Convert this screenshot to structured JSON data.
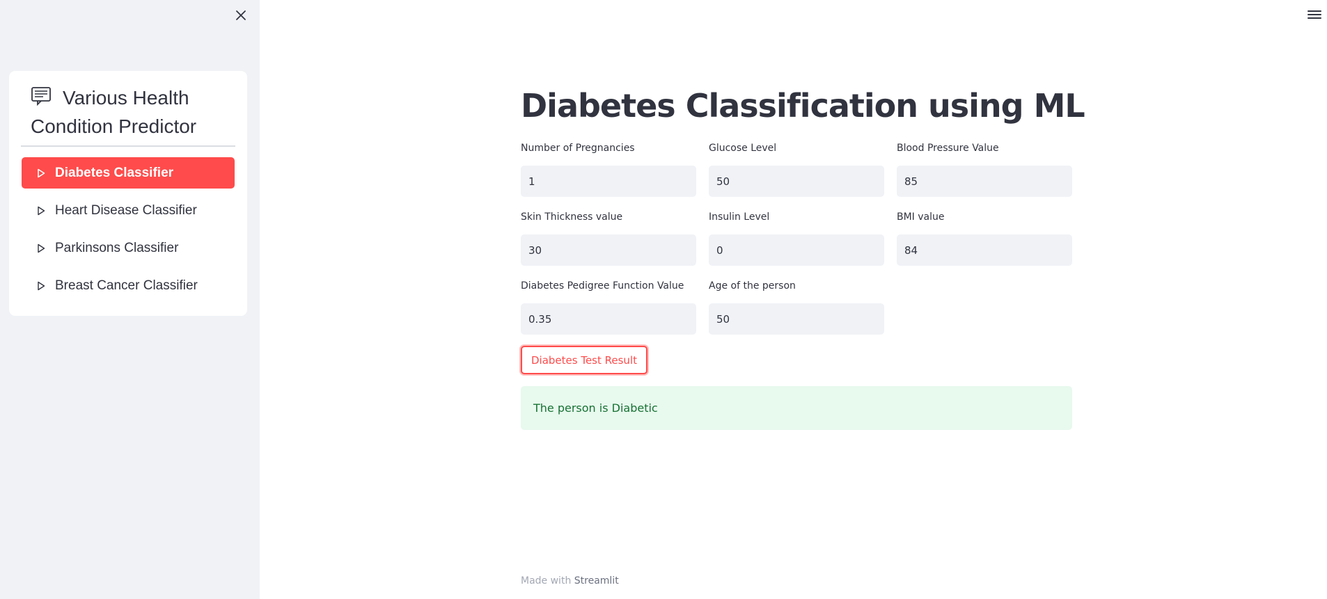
{
  "sidebar": {
    "menu_title": "Various Health Condition Predictor",
    "items": [
      {
        "label": "Diabetes Classifier",
        "active": true
      },
      {
        "label": "Heart Disease Classifier",
        "active": false
      },
      {
        "label": "Parkinsons Classifier",
        "active": false
      },
      {
        "label": "Breast Cancer Classifier",
        "active": false
      }
    ],
    "icons": {
      "close": "close-icon",
      "menu_header": "notes-icon",
      "item": "play-triangle-icon"
    }
  },
  "header": {
    "menu_icon": "hamburger-icon"
  },
  "main": {
    "title": "Diabetes Classification using ML",
    "fields": [
      {
        "label": "Number of Pregnancies",
        "value": "1"
      },
      {
        "label": "Glucose Level",
        "value": "50"
      },
      {
        "label": "Blood Pressure Value",
        "value": "85"
      },
      {
        "label": "Skin Thickness value",
        "value": "30"
      },
      {
        "label": "Insulin Level",
        "value": "0"
      },
      {
        "label": "BMI value",
        "value": "84"
      },
      {
        "label": "Diabetes Pedigree Function Value",
        "value": "0.35"
      },
      {
        "label": "Age of the person",
        "value": "50"
      }
    ],
    "button_label": "Diabetes Test Result",
    "result_text": "The person is Diabetic"
  },
  "footer": {
    "prefix": "Made with",
    "brand": "Streamlit"
  },
  "colors": {
    "accent": "#ff4b4b",
    "sidebar_bg": "#f0f2f6",
    "success_bg": "#e8f9ee",
    "success_text": "#177233",
    "text": "#31333f"
  }
}
